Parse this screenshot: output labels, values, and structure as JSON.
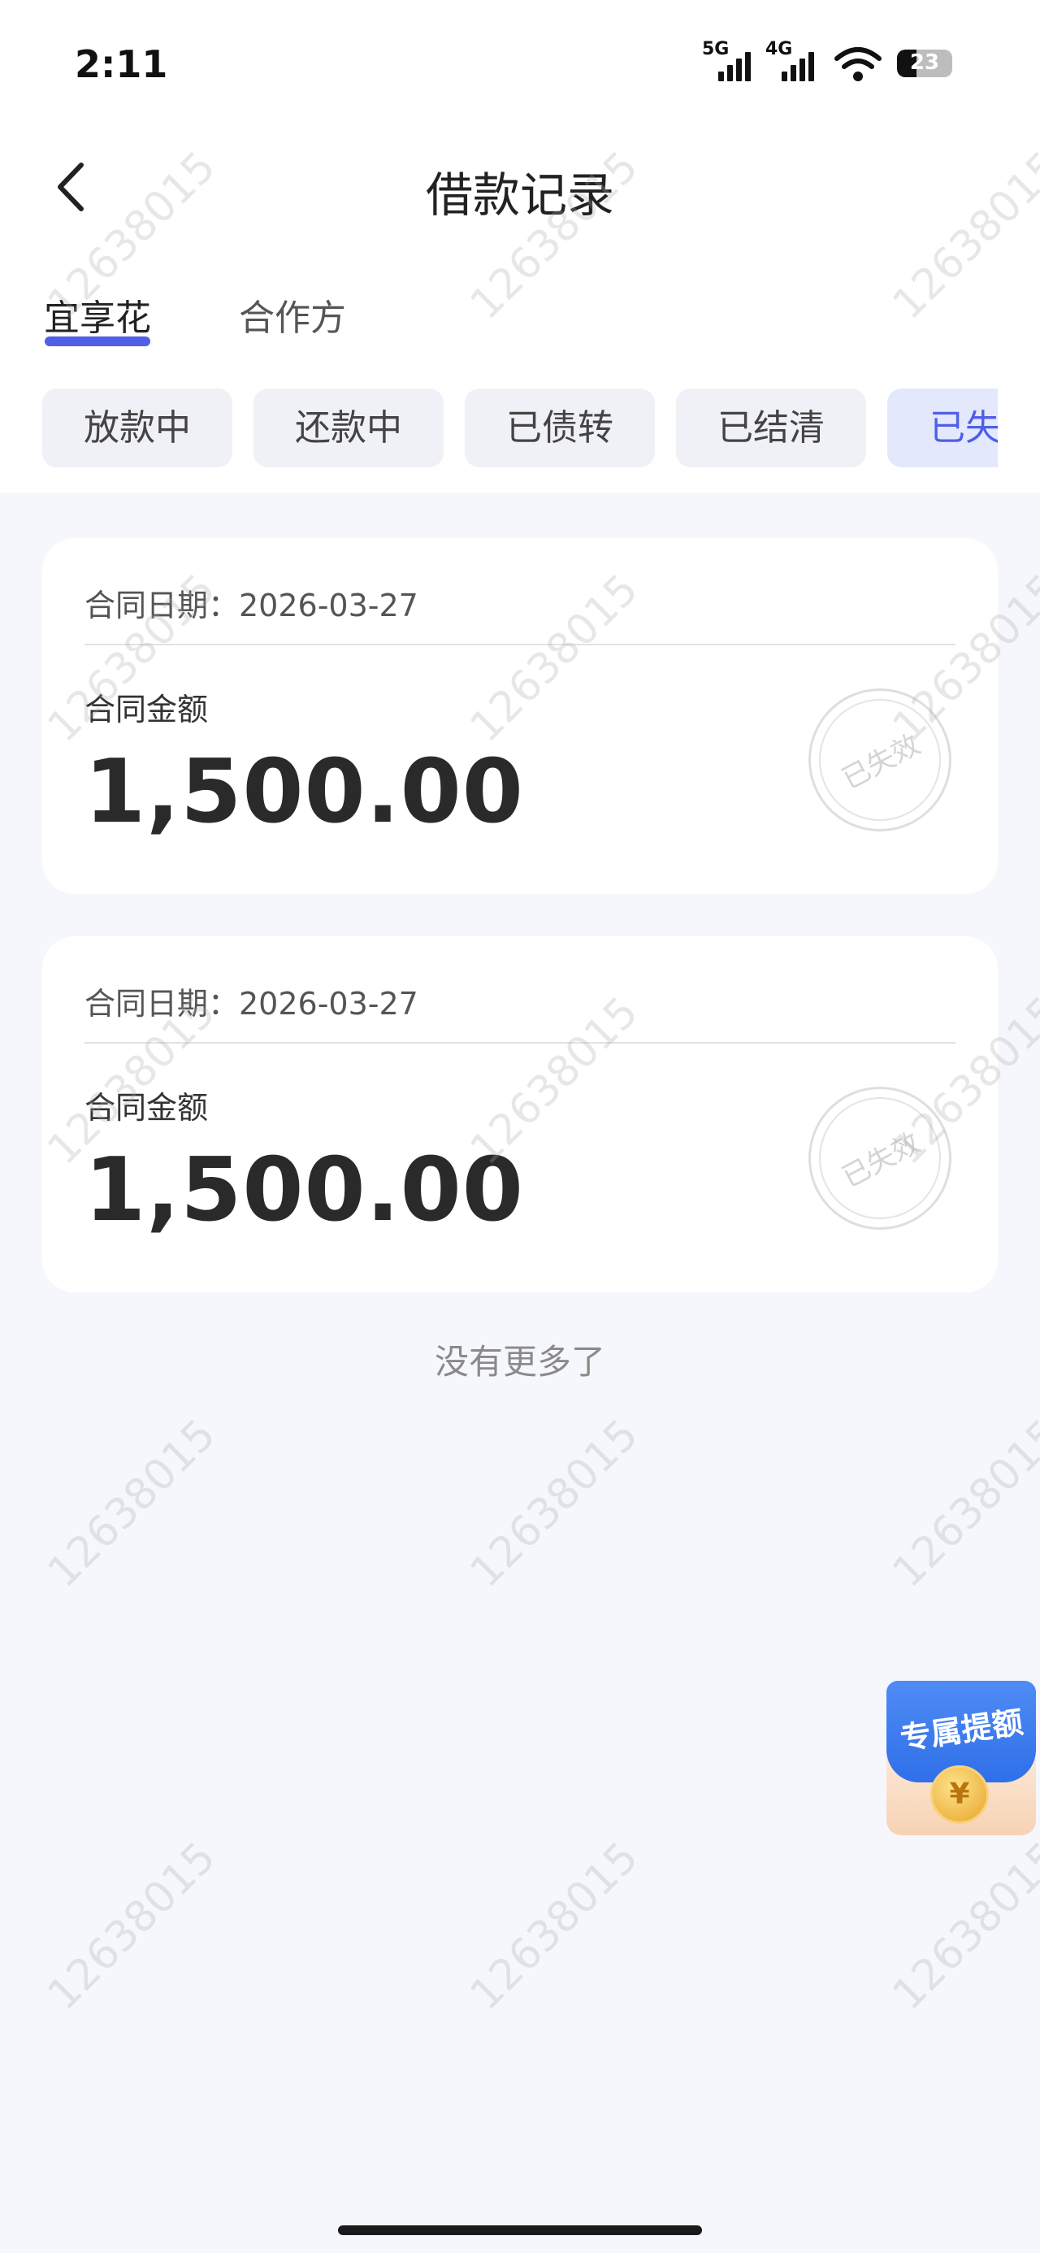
{
  "status_bar": {
    "time": "2:11",
    "net1": "5G",
    "net2": "4G",
    "battery": "23"
  },
  "nav": {
    "title": "借款记录"
  },
  "tabs": [
    {
      "label": "宜享花",
      "active": true
    },
    {
      "label": "合作方",
      "active": false
    }
  ],
  "filters": [
    {
      "label": "放款中"
    },
    {
      "label": "还款中"
    },
    {
      "label": "已债转"
    },
    {
      "label": "已结清"
    },
    {
      "label": "已失",
      "active": true
    }
  ],
  "records": [
    {
      "date_label": "合同日期：2026-03-27",
      "amount_label": "合同金额",
      "amount": "1,500.00",
      "status": "已失效"
    },
    {
      "date_label": "合同日期：2026-03-27",
      "amount_label": "合同金额",
      "amount": "1,500.00",
      "status": "已失效"
    }
  ],
  "list_end": "没有更多了",
  "promo": {
    "label": "专属提额",
    "coin": "¥"
  },
  "watermark": "12638015",
  "colors": {
    "accent": "#4f5fe6",
    "background": "#f5f7fd",
    "card": "#ffffff"
  }
}
